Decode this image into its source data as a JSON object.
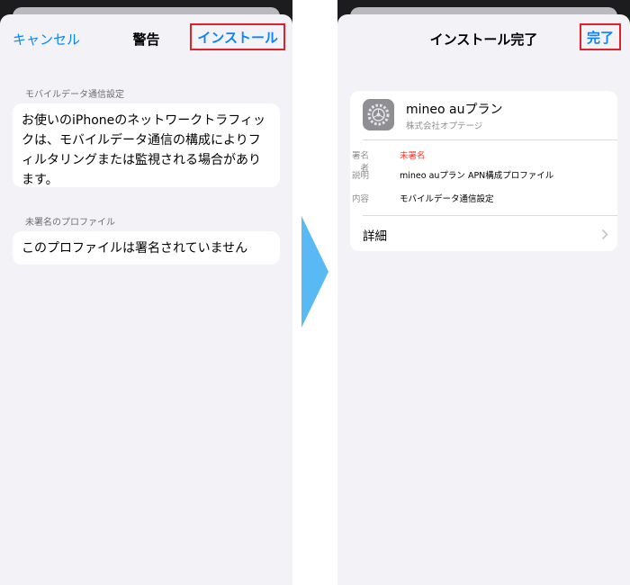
{
  "left_screen": {
    "nav": {
      "cancel_label": "キャンセル",
      "title": "警告",
      "install_label": "インストール"
    },
    "sections": [
      {
        "header": "モバイルデータ通信設定",
        "body": "お使いのiPhoneのネットワークトラフィックは、モバイルデータ通信の構成によりフィルタリングまたは監視される場合があります。"
      },
      {
        "header": "未署名のプロファイル",
        "body": "このプロファイルは署名されていません"
      }
    ]
  },
  "right_screen": {
    "nav": {
      "title": "インストール完了",
      "done_label": "完了"
    },
    "profile": {
      "name": "mineo auプラン",
      "organization": "株式会社オプテージ",
      "icon": "settings-gear-icon",
      "details": [
        {
          "key": "署名者",
          "value": "未署名",
          "value_color": "#ff3b30"
        },
        {
          "key": "説明",
          "value": "mineo auプラン APN構成プロファイル"
        },
        {
          "key": "内容",
          "value": "モバイルデータ通信設定"
        }
      ],
      "more_label": "詳細"
    }
  },
  "colors": {
    "accent": "#0a84ff",
    "highlight": "#e0202b",
    "arrow": "#58b9f4",
    "warning": "#ff3b30"
  }
}
